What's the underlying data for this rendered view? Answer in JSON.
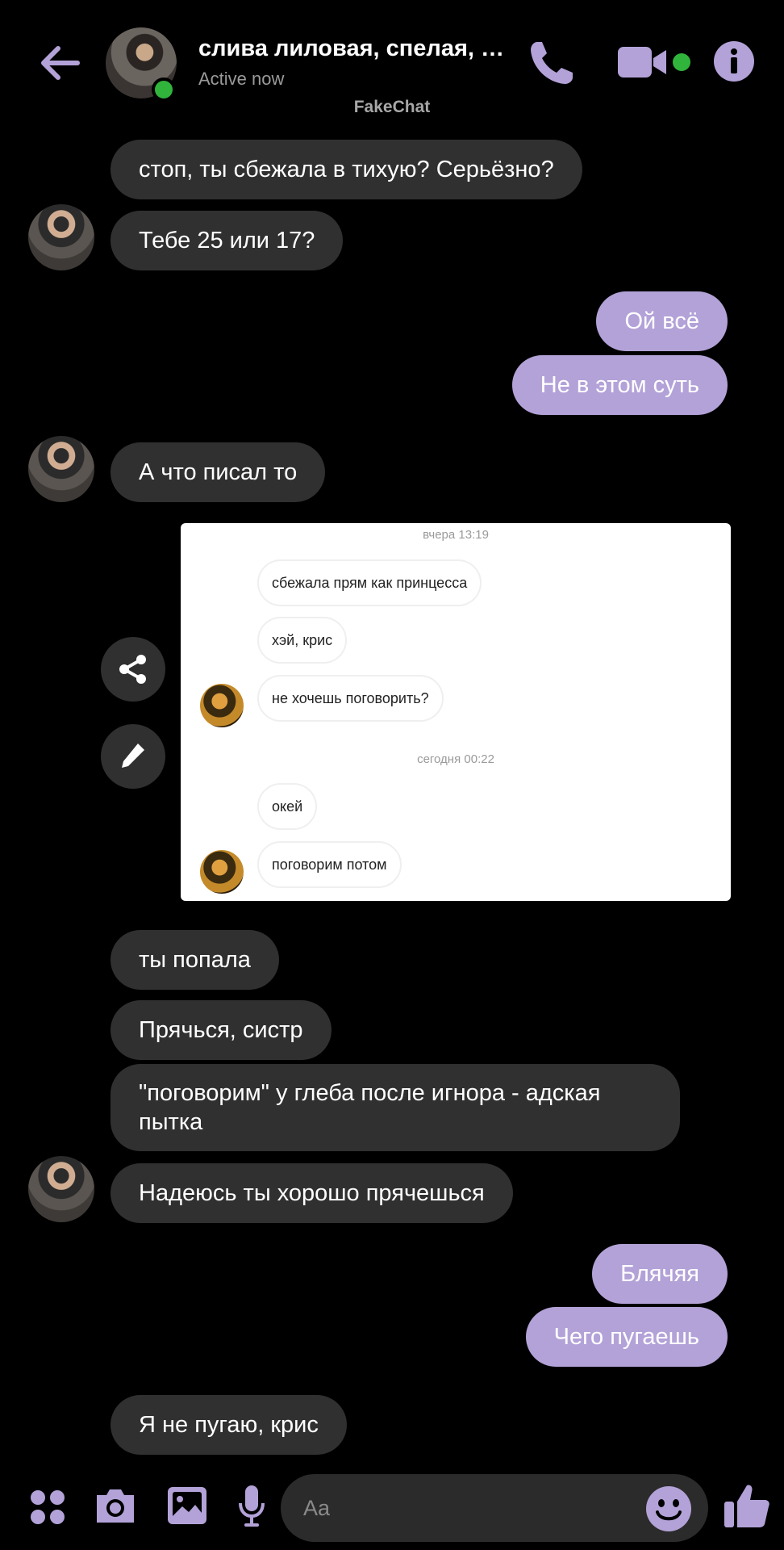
{
  "header": {
    "contact_name": "слива лиловая, спелая, с...",
    "status": "Active now",
    "watermark": "FakeChat"
  },
  "colors": {
    "accent": "#b3a2d8",
    "incoming_bubble": "#303030",
    "online": "#31b43b",
    "background": "#000000"
  },
  "messages": [
    {
      "dir": "in",
      "text": "стоп, ты сбежала в тихую? Серьёзно?"
    },
    {
      "dir": "in",
      "text": "Тебе 25 или 17?"
    },
    {
      "dir": "out",
      "text": "Ой всё"
    },
    {
      "dir": "out",
      "text": "Не в этом суть"
    },
    {
      "dir": "in",
      "text": "А что писал то"
    },
    {
      "dir": "in",
      "text": "ты попала"
    },
    {
      "dir": "in",
      "text": "Прячься, систр"
    },
    {
      "dir": "in",
      "text": "\"поговорим\" у глеба после игнора - адская пытка"
    },
    {
      "dir": "in",
      "text": "Надеюсь ты хорошо прячешься"
    },
    {
      "dir": "out",
      "text": "Блячяя"
    },
    {
      "dir": "out",
      "text": "Чего пугаешь"
    },
    {
      "dir": "in",
      "text": "Я не пугаю, крис"
    }
  ],
  "screenshot": {
    "time1": "вчера 13:19",
    "time2": "сегодня 00:22",
    "bubbles": [
      "сбежала прям как принцесса",
      "хэй, крис",
      "не хочешь поговорить?",
      "окей",
      "поговорим потом"
    ]
  },
  "composer": {
    "placeholder": "Aa"
  },
  "icons": [
    "back-arrow-icon",
    "phone-icon",
    "video-icon",
    "info-icon",
    "share-icon",
    "pencil-icon",
    "apps-icon",
    "camera-icon",
    "gallery-icon",
    "mic-icon",
    "emoji-icon",
    "thumbs-up-icon"
  ]
}
